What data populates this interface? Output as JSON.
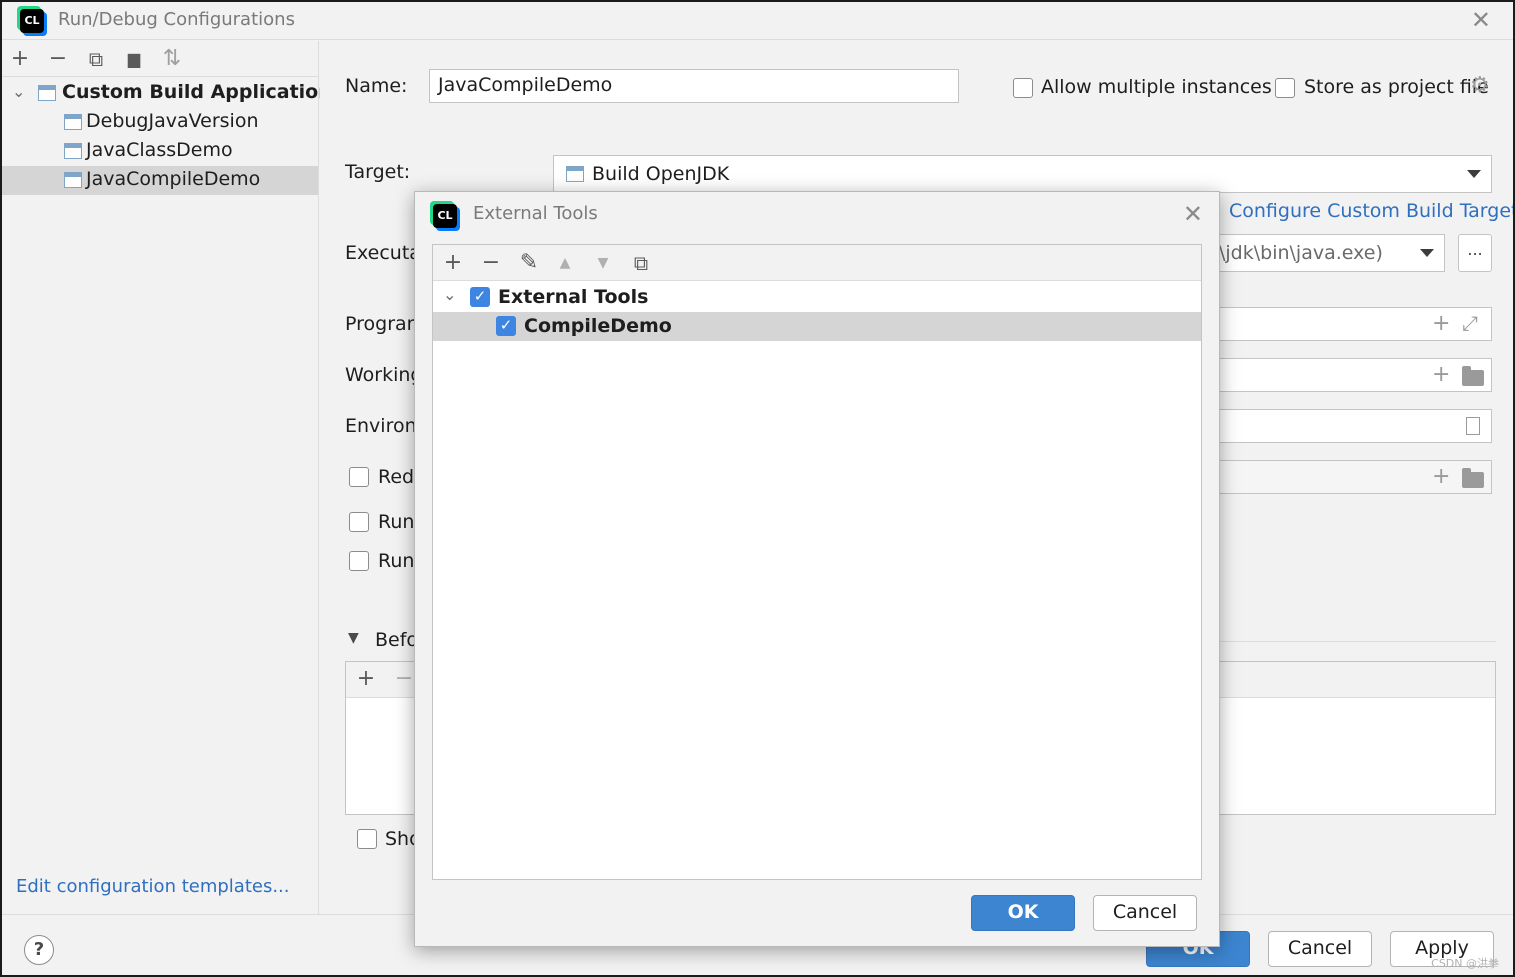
{
  "window": {
    "title": "Run/Debug Configurations",
    "app_icon_text": "CL",
    "close_glyph": "✕"
  },
  "left_toolbar": {
    "add": "+",
    "remove": "−",
    "copy": "⧉",
    "folder": "▆",
    "sort": "⇅"
  },
  "tree": {
    "chevron": "⌄",
    "group": "Custom Build Application",
    "items": [
      "DebugJavaVersion",
      "JavaClassDemo",
      "JavaCompileDemo"
    ],
    "selected": "JavaCompileDemo"
  },
  "edit_templates_link": "Edit configuration templates...",
  "form": {
    "name_label": "Name:",
    "name_value": "JavaCompileDemo",
    "allow_multiple": "Allow multiple instances",
    "store_project": "Store as project file",
    "target_label": "Target:",
    "target_value": "Build OpenJDK",
    "configure_link": "Configure Custom Build Targets",
    "executable_label": "Executab",
    "executable_value": "\\jdk\\bin\\java.exe)",
    "browse_label": "...",
    "program_label": "Program",
    "working_label": "Working",
    "environment_label": "Environn",
    "redirect_label": "Redi",
    "run1_label": "Run",
    "run2_label": "Run",
    "before_label": "Befo",
    "show_label": "Sho",
    "plus": "+",
    "minus": "−",
    "expand": "⤢"
  },
  "modal": {
    "title": "External Tools",
    "app_icon_text": "CL",
    "close_glyph": "✕",
    "toolbar": {
      "add": "+",
      "remove": "−",
      "edit": "✎",
      "up": "▲",
      "down": "▼",
      "copy": "⧉"
    },
    "group": {
      "label": "External Tools",
      "checked": true
    },
    "items": [
      {
        "label": "CompileDemo",
        "checked": true
      }
    ],
    "check_glyph": "✓",
    "chevron": "⌄",
    "ok": "OK",
    "cancel": "Cancel"
  },
  "bottom": {
    "help": "?",
    "ok": "OK",
    "cancel": "Cancel",
    "apply": "Apply",
    "watermark": "CSDN @洪拳"
  },
  "colors": {
    "accent_blue": "#3d85d0",
    "link_blue": "#2f6fc0",
    "selection_gray": "#d5d5d5",
    "panel_bg": "#f2f2f2"
  }
}
